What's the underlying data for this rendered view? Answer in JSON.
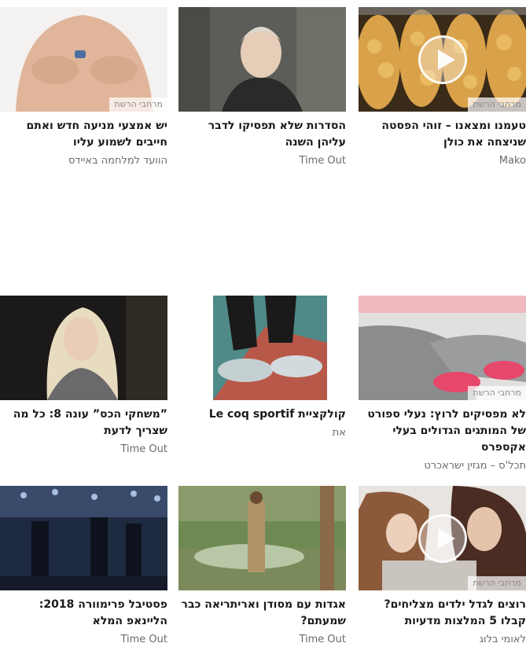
{
  "badge_label": "מרחבי הרשת",
  "cards": [
    {
      "title": "טעמנו ומצאנו – זוהי הפסטה שניצחה את כולן",
      "source": "Mako",
      "badge": true,
      "video": true,
      "thumb_icon": "pasta-photo"
    },
    {
      "title": "הסדרות שלא תפסיקו לדבר עליהן השנה",
      "source": "Time Out",
      "badge": false,
      "video": false,
      "thumb_icon": "woman-beanie-photo"
    },
    {
      "title": "יש אמצעי מניעה חדש ואתם חייבים לשמוע עליו",
      "source": "הוועד למלחמה באיידס",
      "badge": true,
      "video": false,
      "thumb_icon": "man-holding-pill-photo"
    },
    {
      "title": "לא מפסיקים לרוץ: נעלי ספורט של המותגים הגדולים בעלי אקספרס",
      "source": "תכל'ס – מגזין ישראכרט",
      "badge": true,
      "video": false,
      "thumb_icon": "sneakers-leggings-photo"
    },
    {
      "title": "קולקציית Le coq sportif",
      "source": "את",
      "badge": false,
      "video": false,
      "thumb_icon": "silver-shoes-photo"
    },
    {
      "title": "”משחקי הכס” עונה 8: כל מה שצריך לדעת",
      "source": "Time Out",
      "badge": false,
      "video": false,
      "thumb_icon": "blonde-character-photo"
    },
    {
      "title": "רוצים לגדל ילדים מצליחים? קבלו 5 המלצות מדעיות",
      "source": "לאומי בלוג",
      "badge": true,
      "video": true,
      "thumb_icon": "mother-daughter-photo"
    },
    {
      "title": "אגדות עם מסודן ואריתריאה כבר שמעתם?",
      "source": "Time Out",
      "badge": false,
      "video": false,
      "thumb_icon": "man-by-pond-photo"
    },
    {
      "title": "פסטיבל פרימוורה 2018: הליינאפ המלא",
      "source": "Time Out",
      "badge": false,
      "video": false,
      "thumb_icon": "concert-stage-photo"
    }
  ]
}
